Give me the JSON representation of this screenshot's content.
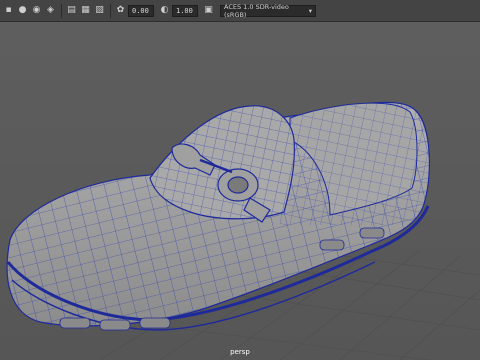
{
  "toolbar": {
    "exposure_value": "0.00",
    "gamma_value": "1.00",
    "color_space": "ACES 1.0 SDR-video (sRGB)",
    "icons": [
      "select-camera-icon",
      "lock-camera-icon",
      "bookmark-icon",
      "image-plane-icon",
      "grid-icon",
      "film-gate-icon",
      "resolution-gate-icon",
      "exposure-icon",
      "gamma-icon",
      "colorspace-dropdown-icon"
    ]
  },
  "viewport": {
    "camera_name": "persp",
    "background_color": "#5a5a5a",
    "wire_color": "#1f2a9a",
    "mesh_color": "#9c9c9c"
  }
}
